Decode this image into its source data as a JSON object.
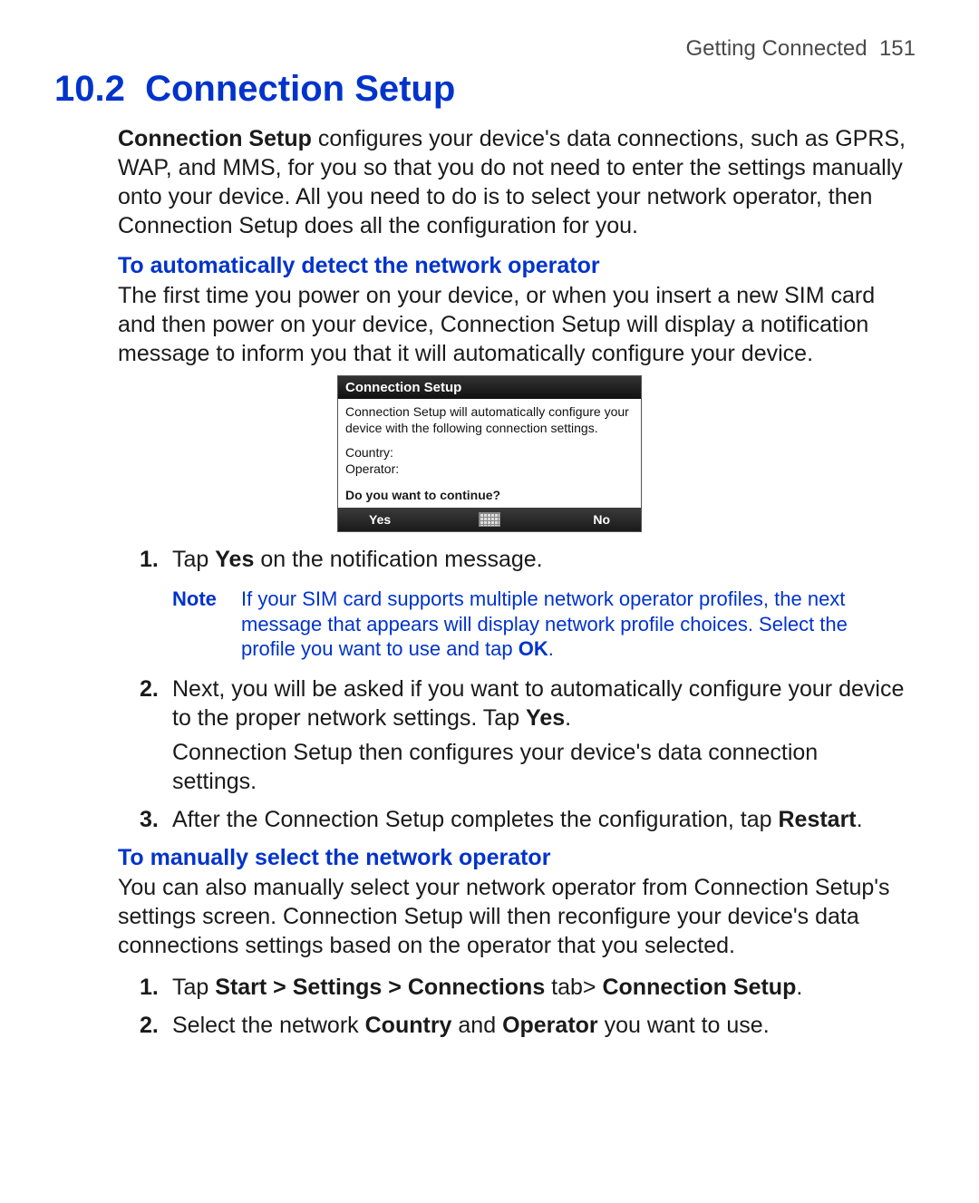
{
  "header": {
    "chapter": "Getting Connected",
    "page_number": "151"
  },
  "section": {
    "number": "10.2",
    "title": "Connection Setup"
  },
  "intro": {
    "lead_bold": "Connection Setup",
    "lead_rest": " configures your device's data connections, such as GPRS, WAP, and MMS, for you so that you do not need to enter the settings manually onto your device. All you need to do is to select your network operator, then Connection Setup does all the configuration for you."
  },
  "auto": {
    "heading": "To automatically detect the network operator",
    "para": "The first time you power on your device, or when you insert a new SIM card and then power on your device, Connection Setup will display a notification message to inform you that it will automatically configure your device.",
    "dialog": {
      "title": "Connection Setup",
      "message": "Connection Setup will automatically configure your device with the following connection settings.",
      "country_label": "Country:",
      "operator_label": "Operator:",
      "prompt": "Do you want to continue?",
      "yes": "Yes",
      "no": "No"
    },
    "steps": [
      {
        "num": "1.",
        "pre": "Tap ",
        "bold1": "Yes",
        "post": " on the notification message."
      },
      {
        "num": "2.",
        "pre": "Next, you will be asked if you want to automatically configure your device to the proper network settings. Tap ",
        "bold1": "Yes",
        "post": ".",
        "extra": "Connection Setup then configures your device's data connection settings."
      },
      {
        "num": "3.",
        "pre": "After the Connection Setup completes the configuration, tap ",
        "bold1": "Restart",
        "post": "."
      }
    ],
    "note": {
      "label": "Note",
      "text_pre": "If your SIM card supports multiple network operator profiles, the next message that appears will display network profile choices. Select the profile you want to use and tap ",
      "text_bold": "OK",
      "text_post": "."
    }
  },
  "manual": {
    "heading": "To manually select the network operator",
    "para": "You can also manually select your network operator from Connection Setup's settings screen. Connection Setup will then reconfigure your device's data connections settings based on the operator that you selected.",
    "steps": [
      {
        "num": "1.",
        "t0": "Tap ",
        "b0": "Start > Settings > Connections",
        "t1": " tab> ",
        "b1": "Connection Setup",
        "t2": "."
      },
      {
        "num": "2.",
        "t0": "Select the network ",
        "b0": "Country",
        "t1": " and ",
        "b1": "Operator",
        "t2": " you want to use."
      }
    ]
  }
}
